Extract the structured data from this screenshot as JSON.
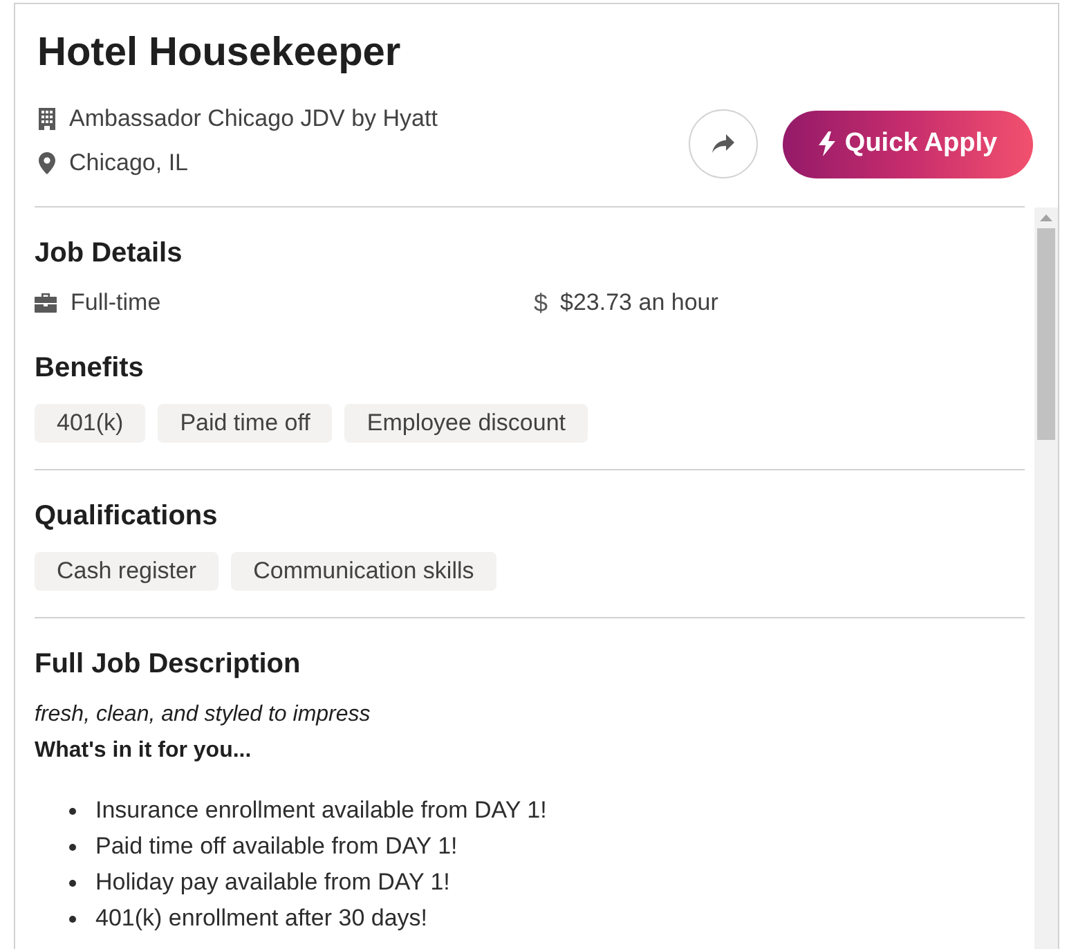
{
  "job": {
    "title": "Hotel Housekeeper",
    "company": "Ambassador Chicago JDV by Hyatt",
    "location": "Chicago, IL"
  },
  "apply_button": {
    "label": "Quick Apply"
  },
  "job_details": {
    "heading": "Job Details",
    "job_type": "Full-time",
    "pay_symbol": "$",
    "pay": "$23.73 an hour"
  },
  "benefits": {
    "heading": "Benefits",
    "tags": [
      "401(k)",
      "Paid time off",
      "Employee discount"
    ]
  },
  "qualifications": {
    "heading": "Qualifications",
    "tags": [
      "Cash register",
      "Communication skills"
    ]
  },
  "description": {
    "heading": "Full Job Description",
    "tagline": "fresh, clean, and styled to impress",
    "subheading": "What's in it for you...",
    "bullets": [
      "Insurance enrollment available from DAY 1!",
      "Paid time off available from DAY 1!",
      "Holiday pay available from DAY 1!",
      "401(k) enrollment after 30 days!"
    ]
  }
}
